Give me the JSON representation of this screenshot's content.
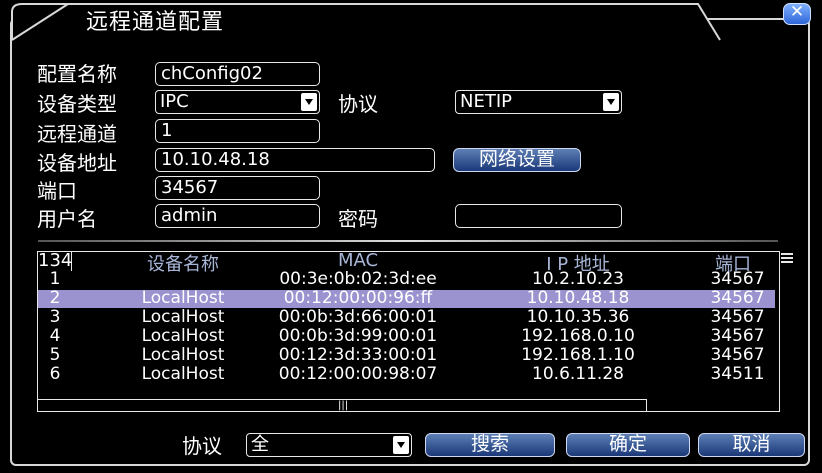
{
  "window": {
    "title": "远程通道配置"
  },
  "form": {
    "config_name_label": "配置名称",
    "config_name_value": "chConfig02",
    "device_type_label": "设备类型",
    "device_type_value": "IPC",
    "protocol_label": "协议",
    "protocol_value": "NETIP",
    "remote_channel_label": "远程通道",
    "remote_channel_value": "1",
    "device_address_label": "设备地址",
    "device_address_value": "10.10.48.18",
    "network_settings_button": "网络设置",
    "port_label": "端口",
    "port_value": "34567",
    "username_label": "用户名",
    "username_value": "admin",
    "password_label": "密码",
    "password_value": ""
  },
  "device_table": {
    "count": "134",
    "columns": [
      "设备名称",
      "MAC",
      "I P 地址",
      "端口"
    ],
    "rows": [
      {
        "index": "1",
        "name": "",
        "mac": "00:3e:0b:02:3d:ee",
        "ip": "10.2.10.23",
        "port": "34567",
        "selected": false
      },
      {
        "index": "2",
        "name": "LocalHost",
        "mac": "00:12:00:00:96:ff",
        "ip": "10.10.48.18",
        "port": "34567",
        "selected": true
      },
      {
        "index": "3",
        "name": "LocalHost",
        "mac": "00:0b:3d:66:00:01",
        "ip": "10.10.35.36",
        "port": "34567",
        "selected": false
      },
      {
        "index": "4",
        "name": "LocalHost",
        "mac": "00:0b:3d:99:00:01",
        "ip": "192.168.0.10",
        "port": "34567",
        "selected": false
      },
      {
        "index": "5",
        "name": "LocalHost",
        "mac": "00:12:3d:33:00:01",
        "ip": "192.168.1.10",
        "port": "34567",
        "selected": false
      },
      {
        "index": "6",
        "name": "LocalHost",
        "mac": "00:12:00:00:98:07",
        "ip": "10.6.11.28",
        "port": "34511",
        "selected": false
      }
    ]
  },
  "footer": {
    "protocol_label": "协议",
    "protocol_filter_value": "全",
    "search_button": "搜索",
    "ok_button": "确定",
    "cancel_button": "取消"
  },
  "icons": {
    "close": "close-icon",
    "dropdown": "chevron-down-icon",
    "list_menu": "menu-icon",
    "scroll_thumb": "scroll-grip-icon"
  },
  "colors": {
    "selected_row": "#9a93cf",
    "header_text": "#a7b5d7",
    "button_gradient_top": "#5d7fb5",
    "button_gradient_bottom": "#1a3878"
  }
}
